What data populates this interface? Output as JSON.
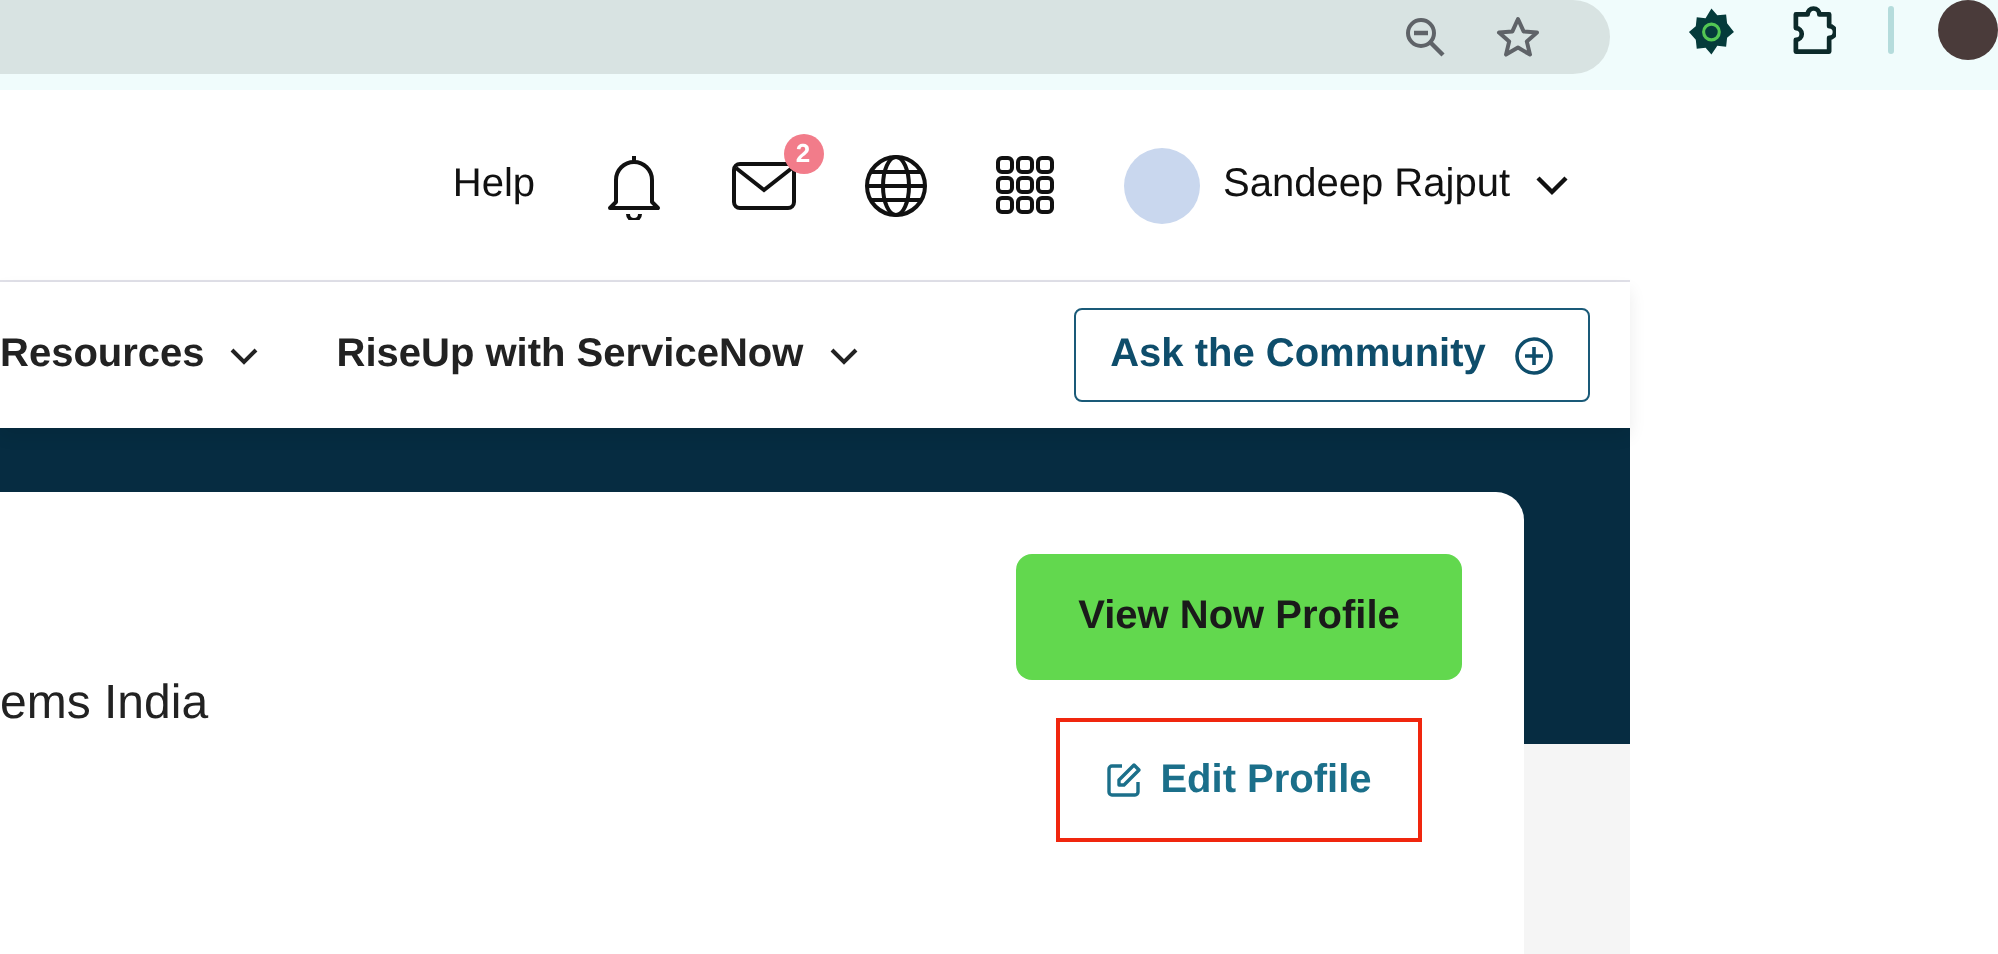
{
  "header": {
    "help": "Help",
    "mail_badge": "2",
    "user_name": "Sandeep Rajput"
  },
  "nav": {
    "items": [
      {
        "label": "Resources"
      },
      {
        "label": "RiseUp with ServiceNow"
      }
    ],
    "cta": "Ask the Community"
  },
  "profile": {
    "company": "ems India",
    "primary_button": "View Now Profile",
    "edit_link": "Edit Profile",
    "highlighted": true
  }
}
